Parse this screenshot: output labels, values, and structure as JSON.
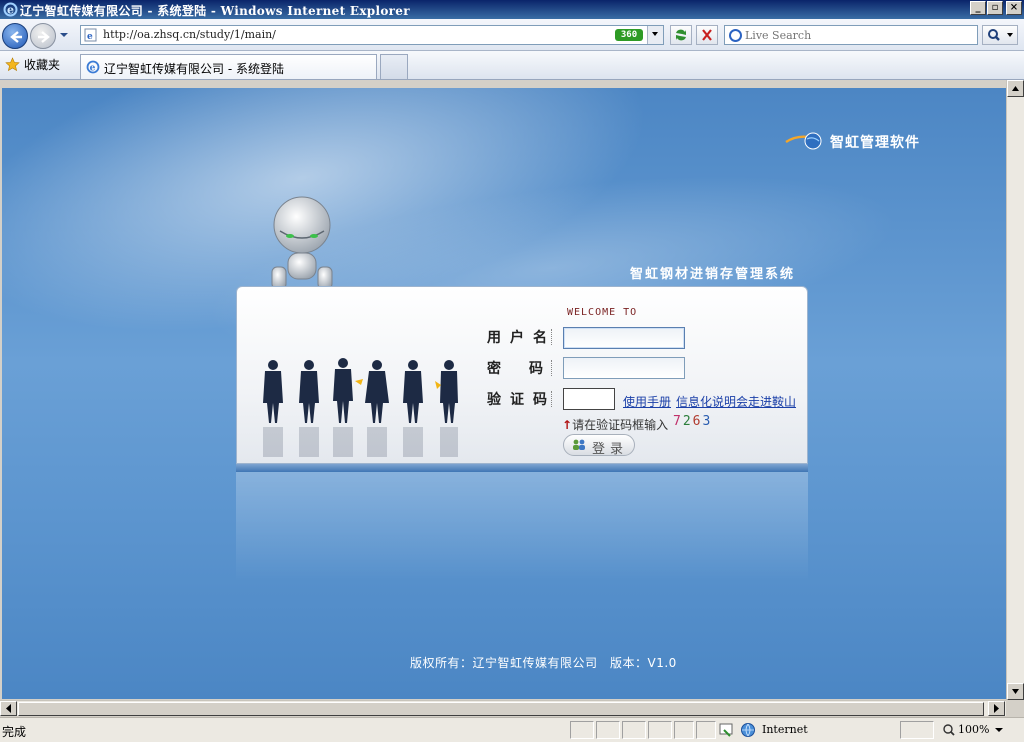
{
  "window": {
    "title": "辽宁智虹传媒有限公司 - 系统登陆 - Windows Internet Explorer"
  },
  "address_bar": {
    "url": "http://oa.zhsq.cn/study/1/main/",
    "badge": "360"
  },
  "search": {
    "placeholder": "Live Search"
  },
  "favorites": {
    "label": "收藏夹"
  },
  "tabs": [
    {
      "label": "辽宁智虹传媒有限公司 - 系统登陆"
    }
  ],
  "page": {
    "brand": "智虹管理软件",
    "system_title": "智虹钢材进销存管理系统",
    "welcome": "WELCOME TO",
    "form": {
      "username_label": "用户名",
      "password_label": "密码",
      "captcha_label": "验证码",
      "username_value": "",
      "password_value": "",
      "captcha_value": "",
      "manual_link": "使用手册",
      "info_link": "信息化说明会走进鞍山",
      "hint": "请在验证码框输入",
      "captcha_digits": [
        "7",
        "2",
        "6",
        "3"
      ],
      "login_button": "登录"
    },
    "copyright": "版权所有：辽宁智虹传媒有限公司　版本：V1.0"
  },
  "statusbar": {
    "status": "完成",
    "zone": "Internet",
    "zoom": "100%"
  },
  "colors": {
    "page_bg": "#5c95cf",
    "link": "#1a3fa8",
    "welcome": "#7a2222",
    "title_bar": "#0a246a"
  }
}
